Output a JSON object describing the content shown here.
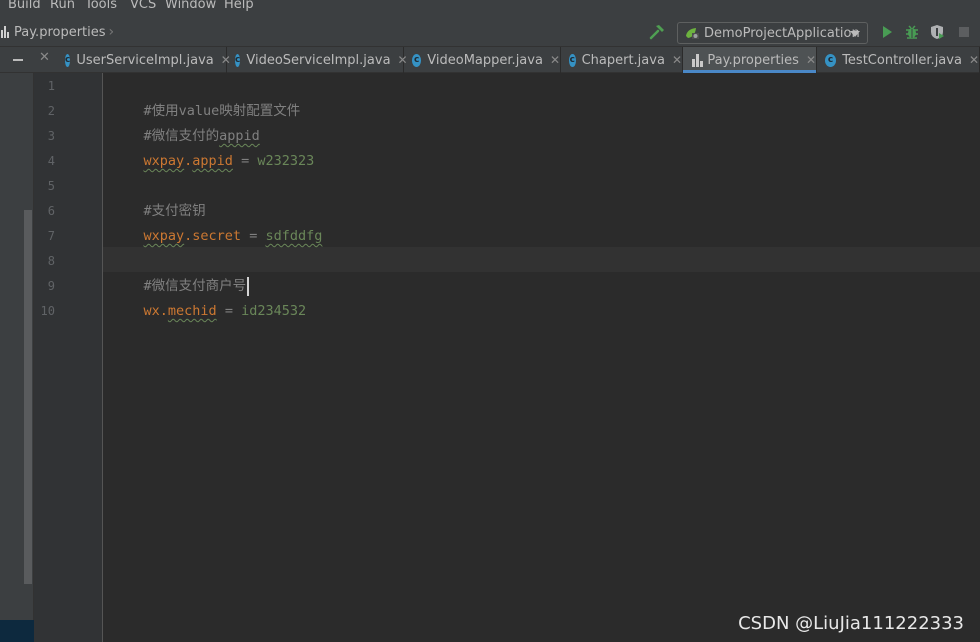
{
  "menu": [
    "Build",
    "Run",
    "Tools",
    "VCS",
    "Window",
    "Help"
  ],
  "breadcrumb": {
    "file": "Pay.properties"
  },
  "run_config": {
    "label": "DemoProjectApplication"
  },
  "tabs": [
    {
      "label": "UserServiceImpl.java",
      "icon": "class-icon",
      "active": false
    },
    {
      "label": "VideoServiceImpl.java",
      "icon": "class-icon",
      "active": false
    },
    {
      "label": "VideoMapper.java",
      "icon": "class-icon",
      "active": false
    },
    {
      "label": "Chapert.java",
      "icon": "class-icon",
      "active": false
    },
    {
      "label": "Pay.properties",
      "icon": "properties-icon",
      "active": true
    },
    {
      "label": "TestController.java",
      "icon": "class-icon",
      "active": false
    }
  ],
  "editor": {
    "line_numbers": [
      "1",
      "2",
      "3",
      "4",
      "5",
      "6",
      "7",
      "8",
      "9",
      "10"
    ],
    "current_line": 8,
    "lines": {
      "l1": "#使用value映射配置文件",
      "l2_text": "#微信支付的",
      "l2_word": "appid",
      "l3_prefix": "wxpay",
      "l3_dot": ".",
      "l3_key": "appid",
      "l3_eq": " = ",
      "l3_val": "w232323",
      "l5": "#支付密钥",
      "l6_prefix": "wxpay",
      "l6_rest": ".secret",
      "l6_eq": " = ",
      "l6_val": "sdfddfg",
      "l8": "#微信支付商户号",
      "l9_prefix": "wx.",
      "l9_key": "mechid",
      "l9_eq": " = ",
      "l9_val": "id234532"
    }
  },
  "watermark": "CSDN @LiuJia111222333",
  "colors": {
    "keyword": "#cc7832",
    "comment": "#808080",
    "value": "#6a8759",
    "accent_tab": "#4a88c7",
    "run_green": "#499c54"
  }
}
